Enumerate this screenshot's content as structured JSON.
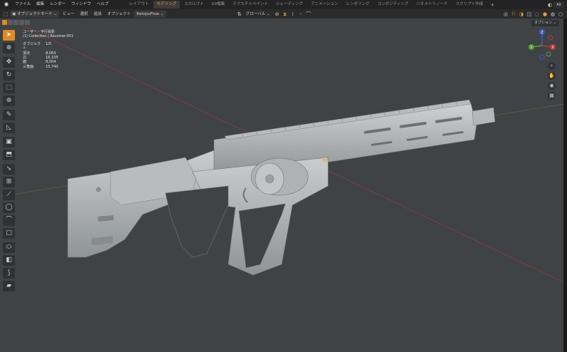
{
  "topbar": {
    "menus": [
      "ファイル",
      "編集",
      "レンダー",
      "ウィンドウ",
      "ヘルプ"
    ],
    "workspaces": [
      "レイアウト",
      "モデリング",
      "スカルプト",
      "UV編集",
      "テクスチャペイント",
      "シェーディング",
      "アニメーション",
      "レンダリング",
      "コンポジティング",
      "ジオメトリノード",
      "スクリプト作成"
    ],
    "add_symbol": "+",
    "scene": "Alt"
  },
  "header": {
    "mode": "オブジェクトモード",
    "view": "ビュー",
    "select": "選択",
    "add": "追加",
    "object": "オブジェクト",
    "addon": "RetopoFlow",
    "transform": "グローバル"
  },
  "viewport": {
    "view_name": "ユーザー・平行投影",
    "collection": "(1) Collection | Revolver.001",
    "stats": [
      {
        "label": "オブジェクト",
        "value": "1/5"
      },
      {
        "label": "頂点",
        "value": "8,063"
      },
      {
        "label": "辺",
        "value": "16,105"
      },
      {
        "label": "面",
        "value": "8,054"
      },
      {
        "label": "三角面",
        "value": "15,740"
      }
    ],
    "options": "オプション",
    "gizmo": {
      "x": "X",
      "y": "Y",
      "z": "Z"
    }
  },
  "colors": {
    "accent": "#e08a20",
    "viewport_bg": "#3f4345",
    "x_axis": "#b03a3a",
    "y_axis": "#5a8a3a"
  },
  "icons": {
    "tools": [
      "select-cursor-icon",
      "cursor-icon",
      "move-icon",
      "rotate-icon",
      "scale-icon",
      "transform-icon",
      "annotate-icon",
      "measure-icon",
      "add-cube-icon",
      "extrude-icon",
      "inset-icon",
      "bevel-icon",
      "loop-cut-icon",
      "knife-icon",
      "poly-build-icon",
      "spin-icon",
      "smooth-icon",
      "edge-slide-icon",
      "shrink-icon",
      "shear-icon",
      "rip-icon"
    ],
    "nav": [
      "zoom-icon",
      "pan-icon",
      "camera-icon",
      "grid-icon"
    ]
  }
}
